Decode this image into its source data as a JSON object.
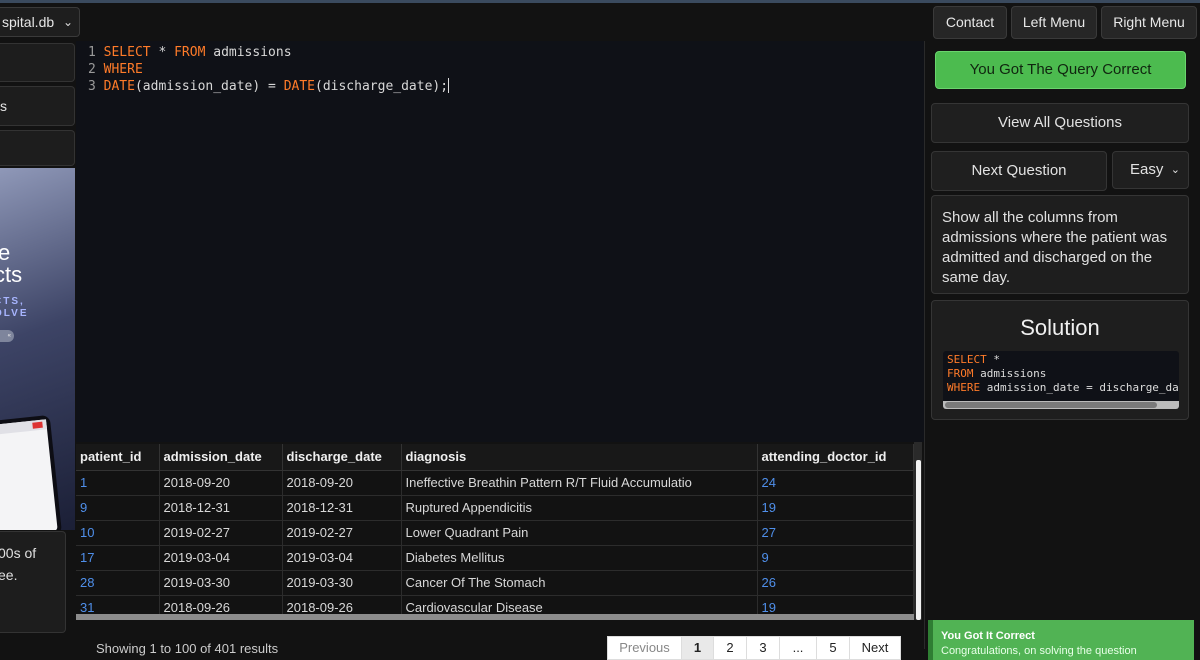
{
  "topbar": {
    "db_select": "spital.db",
    "contact": "Contact",
    "left_menu": "Left Menu",
    "right_menu": "Right Menu"
  },
  "left": {
    "item_s": "s",
    "ad_line1": "e",
    "ad_line2": "cts",
    "ad_line3": "CTS,",
    "ad_line4": "OLVE",
    "ad_pill": "«",
    "promo_line1": "00s of",
    "promo_line2": "ee."
  },
  "editor": {
    "lines": [
      {
        "n": "1",
        "a": "SELECT",
        "b": " * ",
        "c": "FROM",
        "d": " admissions"
      },
      {
        "n": "2",
        "a": "WHERE",
        "b": "",
        "c": "",
        "d": ""
      },
      {
        "n": "3",
        "a": "DATE",
        "b": "(admission_date) = ",
        "c": "DATE",
        "d": "(discharge_date);"
      }
    ]
  },
  "results": {
    "columns": [
      "patient_id",
      "admission_date",
      "discharge_date",
      "diagnosis",
      "attending_doctor_id"
    ],
    "rows": [
      [
        "1",
        "2018-09-20",
        "2018-09-20",
        "Ineffective Breathin Pattern R/T Fluid Accumulatio",
        "24"
      ],
      [
        "9",
        "2018-12-31",
        "2018-12-31",
        "Ruptured Appendicitis",
        "19"
      ],
      [
        "10",
        "2019-02-27",
        "2019-02-27",
        "Lower Quadrant Pain",
        "27"
      ],
      [
        "17",
        "2019-03-04",
        "2019-03-04",
        "Diabetes Mellitus",
        "9"
      ],
      [
        "28",
        "2019-03-30",
        "2019-03-30",
        "Cancer Of The Stomach",
        "26"
      ],
      [
        "31",
        "2018-09-26",
        "2018-09-26",
        "Cardiovascular Disease",
        "19"
      ]
    ],
    "footer": "Showing 1 to 100 of 401 results",
    "pager": {
      "previous": "Previous",
      "p1": "1",
      "p2": "2",
      "p3": "3",
      "ellipsis": "...",
      "p5": "5",
      "next": "Next"
    }
  },
  "right": {
    "correct": "You Got The Query Correct",
    "view_all": "View All Questions",
    "next_question": "Next Question",
    "difficulty": "Easy",
    "question": "Show all the columns from admissions where the patient was admitted and discharged on the same day.",
    "solution_title": "Solution",
    "solution_lines": [
      {
        "kw": "SELECT",
        "rest": " *"
      },
      {
        "kw": "FROM",
        "rest": " admissions"
      },
      {
        "kw": "WHERE",
        "rest": " admission_date = discharge_date"
      }
    ]
  },
  "toast": {
    "title": "You Got It Correct",
    "subtitle": "Congratulations, on solving the question"
  },
  "colors": {
    "keyword": "#ff7b29",
    "success": "#4cbb4f",
    "id_link": "#4f8fea"
  }
}
